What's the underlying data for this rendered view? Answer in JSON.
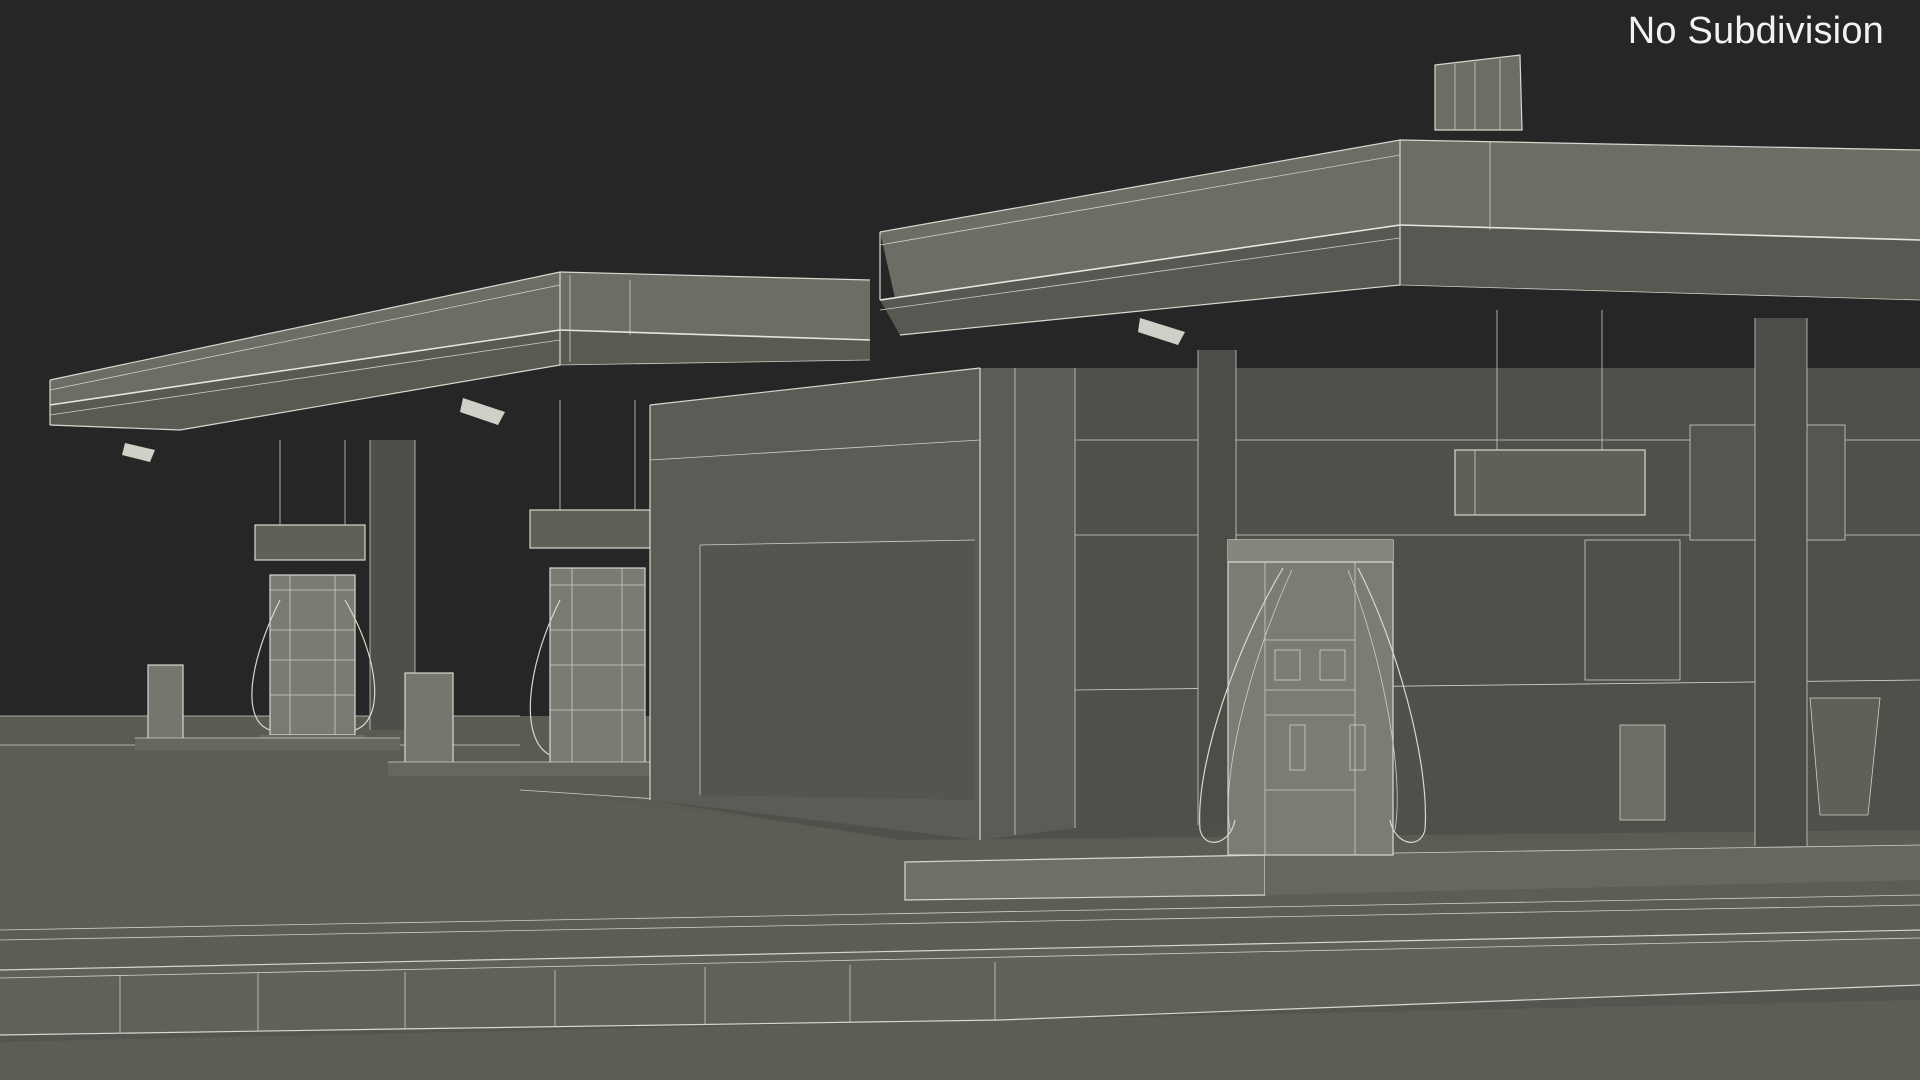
{
  "viewport": {
    "label": "No Subdivision",
    "colors": {
      "background": "#262626",
      "ground": "#5c5d55",
      "wire": "#d8d8d0"
    }
  }
}
